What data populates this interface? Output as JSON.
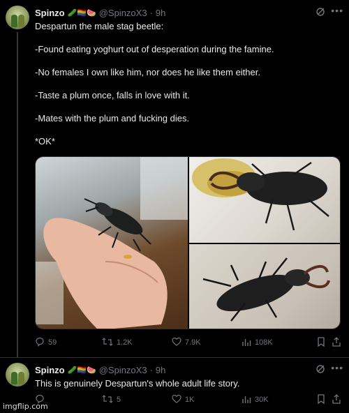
{
  "tweet1": {
    "author": {
      "name": "Spinzo",
      "handle": "@SpinzoX3",
      "emoji": "🥒🏳️‍🌈🍉",
      "time": "9h",
      "dot": "·"
    },
    "lines": [
      "Despartun the male stag beetle:",
      "-Found eating yoghurt out of desperation during the famine.",
      "-No females I own like him, nor does he like them either.",
      "-Taste a plum once, falls in love with it.",
      "-Mates with the plum and fucking dies.",
      "*OK*"
    ],
    "stats": {
      "replies": "59",
      "reposts": "1.2K",
      "likes": "7.9K",
      "views": "108K"
    }
  },
  "tweet2": {
    "author": {
      "name": "Spinzo",
      "handle": "@SpinzoX3",
      "emoji": "🥒🏳️‍🌈🍉",
      "time": "9h",
      "dot": "·"
    },
    "text": "This is genuinely Despartun's whole adult life story.",
    "stats": {
      "replies": "",
      "reposts": "5",
      "likes": "1K",
      "views": "30K"
    }
  },
  "watermark": "imgflip.com",
  "colors": {
    "background": "#000000",
    "text": "#e7e9ea",
    "muted": "#71767b",
    "divider": "#2f3336"
  },
  "icons": [
    "grok-icon",
    "more-icon",
    "reply-icon",
    "repost-icon",
    "like-icon",
    "views-icon",
    "bookmark-icon",
    "share-icon"
  ]
}
